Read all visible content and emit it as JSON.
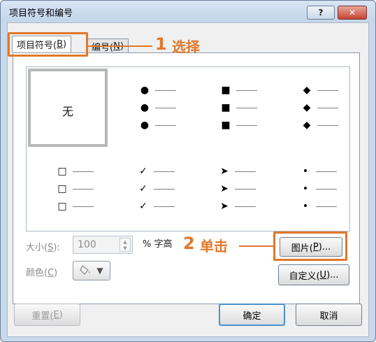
{
  "window": {
    "title": "项目符号和编号",
    "help_label": "?",
    "close_label": "✕"
  },
  "tabs": [
    {
      "label": "项目符号(",
      "key": "B",
      "suffix": ")"
    },
    {
      "label": "编号(",
      "key": "N",
      "suffix": ")"
    }
  ],
  "callouts": [
    {
      "number": "1",
      "text": "选择"
    },
    {
      "number": "2",
      "text": "单击"
    }
  ],
  "gallery": {
    "none_label": "无",
    "styles": [
      {
        "glyph": ""
      },
      {
        "glyph": "●"
      },
      {
        "glyph": "■"
      },
      {
        "glyph": "◆"
      },
      {
        "glyph": "□"
      },
      {
        "glyph": "✓"
      },
      {
        "glyph": "➤"
      },
      {
        "glyph": "•"
      }
    ],
    "selected_index": 0
  },
  "size": {
    "label": "大小(",
    "key": "S",
    "suffix": "):",
    "value": "100",
    "unit": "% 字高"
  },
  "color": {
    "label": "颜色(",
    "key": "C",
    "suffix": ")"
  },
  "buttons": {
    "picture": {
      "label": "图片(",
      "key": "P",
      "suffix": ")..."
    },
    "customize": {
      "label": "自定义(",
      "key": "U",
      "suffix": ")..."
    },
    "reset": {
      "label": "重置(",
      "key": "E",
      "suffix": ")"
    },
    "ok": {
      "label": "确定"
    },
    "cancel": {
      "label": "取消"
    }
  },
  "colors": {
    "accent": "#e0782b",
    "frame": "#c9d9ec"
  },
  "icons": [
    "help-icon",
    "close-icon",
    "spin-up-icon",
    "spin-down-icon",
    "paint-bucket-icon",
    "dropdown-arrow-icon"
  ]
}
